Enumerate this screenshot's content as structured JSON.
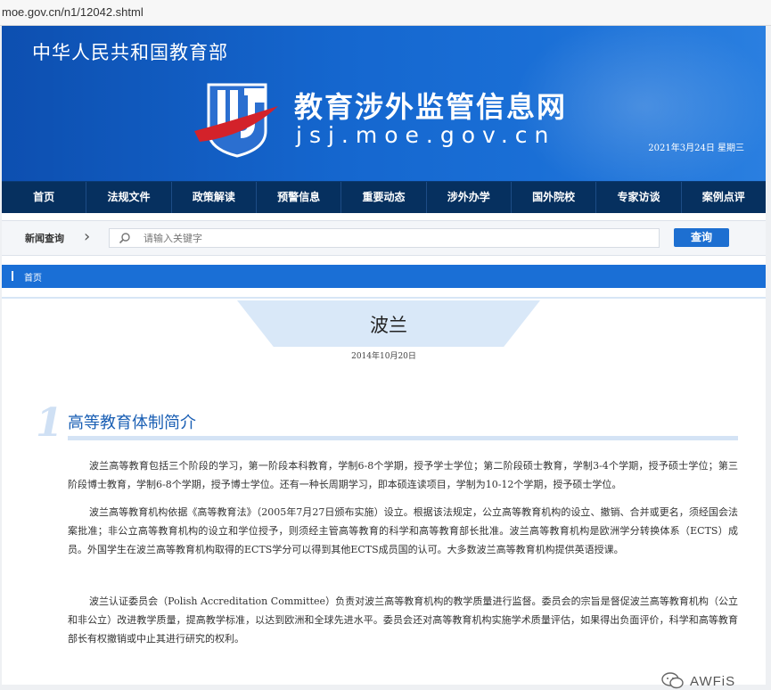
{
  "browser": {
    "url": "moe.gov.cn/n1/12042.shtml"
  },
  "header": {
    "ministry": "中华人民共和国教育部",
    "site_title": "教育涉外监管信息网",
    "domain": "jsj.moe.gov.cn",
    "date": "2021年3月24日  星期三"
  },
  "nav": {
    "items": [
      "首页",
      "法规文件",
      "政策解读",
      "预警信息",
      "重要动态",
      "涉外办学",
      "国外院校",
      "专家访谈",
      "案例点评"
    ]
  },
  "search": {
    "label": "新闻查询",
    "placeholder": "请输入关键字",
    "button": "查询"
  },
  "breadcrumb": {
    "home": "首页"
  },
  "article": {
    "title": "波兰",
    "date": "2014年10月20日",
    "section_number": "1",
    "section_title": "高等教育体制简介",
    "paragraphs": [
      "波兰高等教育包括三个阶段的学习，第一阶段本科教育，学制6-8个学期，授予学士学位；第二阶段硕士教育，学制3-4个学期，授予硕士学位；第三阶段博士教育，学制6-8个学期，授予博士学位。还有一种长周期学习，即本硕连读项目，学制为10-12个学期，授予硕士学位。",
      "波兰高等教育机构依据《高等教育法》（2005年7月27日颁布实施）设立。根据该法规定，公立高等教育机构的设立、撤销、合并或更名，须经国会法案批准；非公立高等教育机构的设立和学位授予，则须经主管高等教育的科学和高等教育部长批准。波兰高等教育机构是欧洲学分转换体系（ECTS）成员。外国学生在波兰高等教育机构取得的ECTS学分可以得到其他ECTS成员国的认可。大多数波兰高等教育机构提供英语授课。",
      "波兰认证委员会（Polish Accreditation Committee）负责对波兰高等教育机构的教学质量进行监督。委员会的宗旨是督促波兰高等教育机构（公立和非公立）改进教学质量，提高教学标准，以达到欧洲和全球先进水平。委员会还对高等教育机构实施学术质量评估，如果得出负面评价，科学和高等教育部长有权撤销或中止其进行研究的权利。"
    ]
  },
  "watermark": {
    "text": "AWFiS"
  }
}
